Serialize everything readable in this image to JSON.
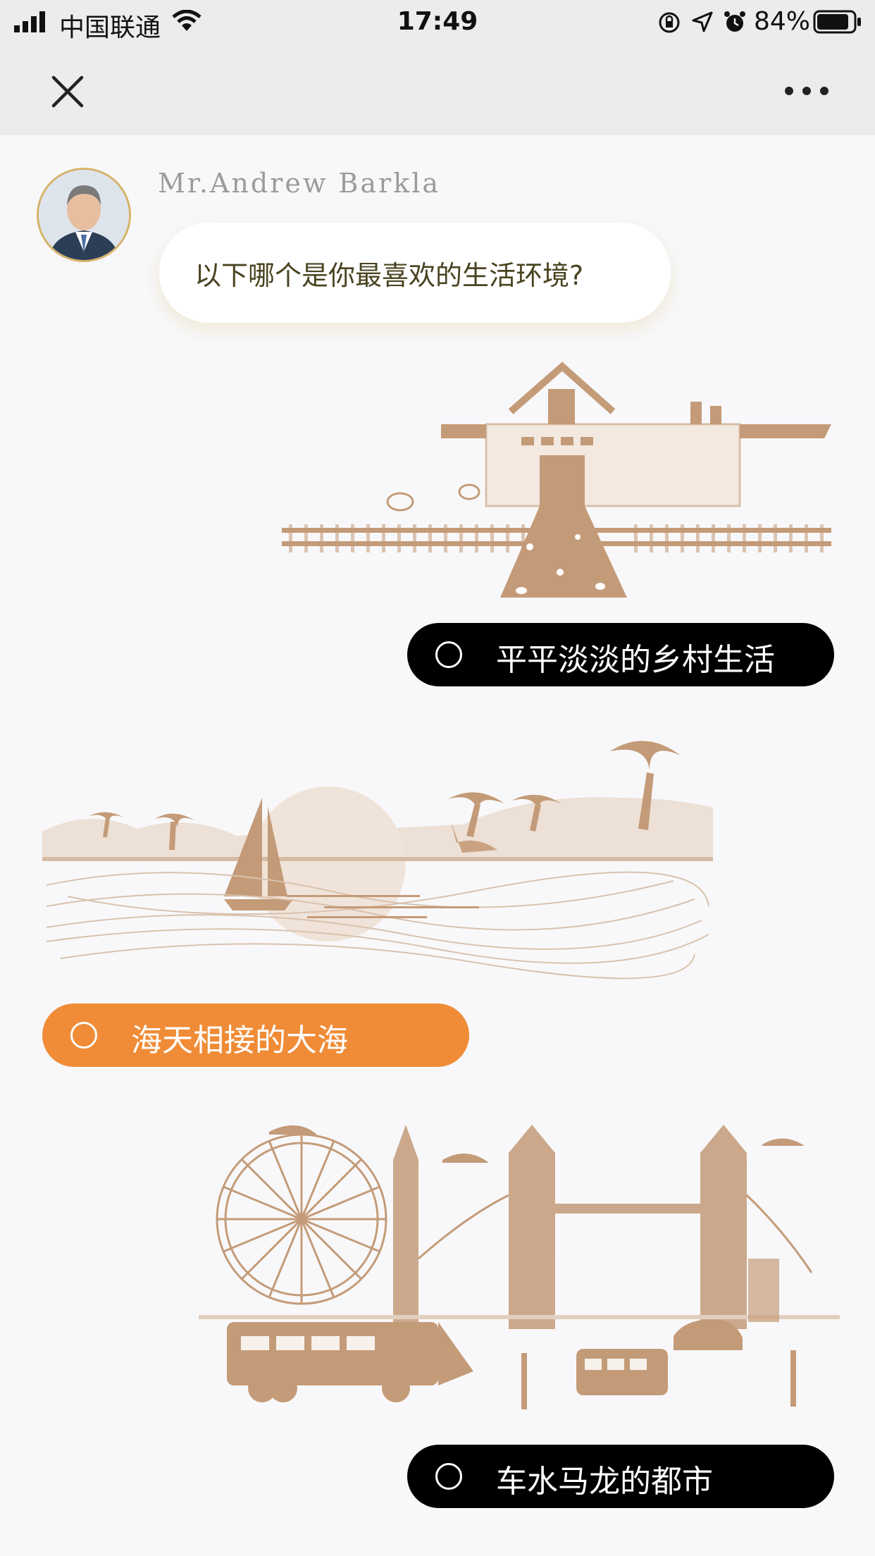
{
  "status_bar": {
    "carrier": "中国联通",
    "time": "17:49",
    "battery": "84%"
  },
  "nav": {
    "close_icon": "close-icon",
    "more_icon": "more-dots-icon"
  },
  "message": {
    "sender": "Mr.Andrew Barkla",
    "question": "以下哪个是你最喜欢的生活环境?"
  },
  "options": [
    {
      "label": "平平淡淡的乡村生活",
      "selected": false,
      "illustration": "countryside-house-illustration"
    },
    {
      "label": "海天相接的大海",
      "selected": true,
      "illustration": "seaside-palm-illustration"
    },
    {
      "label": "车水马龙的都市",
      "selected": false,
      "illustration": "city-london-illustration"
    }
  ],
  "colors": {
    "accent": "#f08c37",
    "option_default": "#000000",
    "illustration": "#c49b78",
    "avatar_ring": "#d6b36a"
  }
}
